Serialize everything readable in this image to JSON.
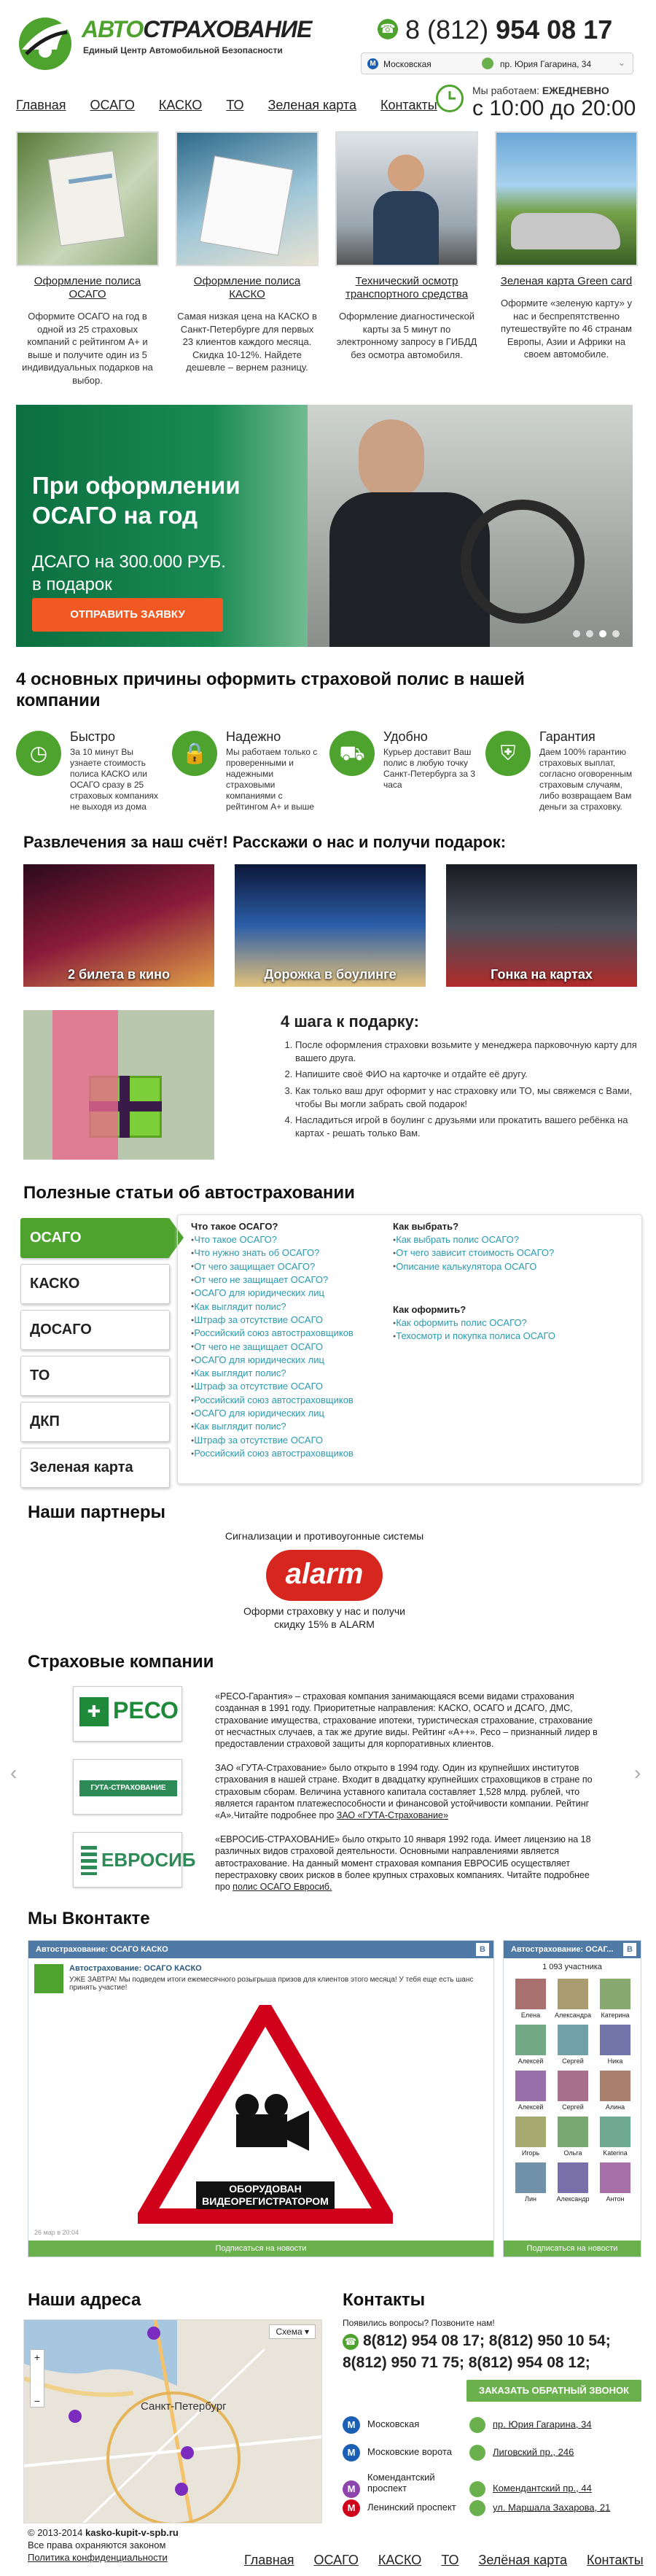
{
  "header": {
    "logo_title_a": "АВТО",
    "logo_title_b": "СТРАХОВАНИЕ",
    "logo_sub": "Единый Центр Автомобильной Безопасности",
    "phone_code": "8 (812)",
    "phone_num": "954 08 17",
    "addr_metro": "Московская",
    "addr_street": "пр. Юрия Гагарина, 34",
    "work_label": "Мы работаем:",
    "work_label_b": "ЕЖЕДНЕВНО",
    "work_hours": "с 10:00 до 20:00",
    "nav": [
      "Главная",
      "ОСАГО",
      "КАСКО",
      "ТО",
      "Зеленая карта",
      "Контакты"
    ]
  },
  "services": [
    {
      "title": "Оформление полиса ОСАГО",
      "desc": "Оформите ОСАГО на год в одной из 25 страховых компаний с рейтингом А+ и выше и получите один из 5 индивидуальных подарков на выбор."
    },
    {
      "title": "Оформление полиса КАСКО",
      "desc": "Самая низкая цена на КАСКО в Санкт-Петербурге для первых 23 клиентов каждого месяца. Скидка 10-12%. Найдете дешевле – вернем разницу."
    },
    {
      "title": "Технический осмотр транспортного средства",
      "desc": "Оформление диагностической карты за 5 минут по электронному запросу в ГИБДД без осмотра автомобиля."
    },
    {
      "title": "Зеленая карта Green card",
      "desc": "Оформите «зеленую карту» у нас и беспрепятственно путешествуйте по 46 странам Европы, Азии и Африки на своем автомобиле."
    }
  ],
  "banner": {
    "title1": "При оформлении",
    "title2": "ОСАГО на год",
    "sub1": "ДСАГО на 300.000 РУБ.",
    "sub2": "в подарок",
    "button": "ОТПРАВИТЬ ЗАЯВКУ"
  },
  "reasons": {
    "heading": "4 основных причины оформить страховой полис в нашей компании",
    "items": [
      {
        "title": "Быстро",
        "desc": "За 10 минут Вы узнаете стоимость полиса КАСКО или ОСАГО сразу в 25 страховых компаниях не выходя из дома"
      },
      {
        "title": "Надежно",
        "desc": "Мы работаем только с проверенными и надежными страховыми компаниями с рейтингом А+ и выше"
      },
      {
        "title": "Удобно",
        "desc": "Курьер доставит Ваш полис в любую точку Санкт-Петербурга за 3 часа"
      },
      {
        "title": "Гарантия",
        "desc": "Даем 100% гарантию страховых выплат, согласно оговоренным страховым случаям, либо возвращаем Вам деньги за страховку."
      }
    ]
  },
  "ent": {
    "heading": "Развлечения за наш счёт! Расскажи о нас и получи подарок:",
    "items": [
      "2 билета в кино",
      "Дорожка в боулинге",
      "Гонка на картах"
    ]
  },
  "steps": {
    "heading": "4 шага к подарку:",
    "items": [
      "После оформления страховки возьмите у менеджера парковочную карту для вашего друга.",
      "Напишите своё ФИО на карточке и отдайте её другу.",
      "Как только ваш друг оформит у нас страховку или ТО, мы свяжемся с Вами, чтобы Вы могли забрать свой подарок!",
      "Насладиться игрой в боулинг с друзьями или прокатить вашего ребёнка на картах - решать только Вам."
    ]
  },
  "articles": {
    "heading": "Полезные статьи об автостраховании",
    "tabs": [
      "ОСАГО",
      "КАСКО",
      "ДОСАГО",
      "ТО",
      "ДКП",
      "Зеленая карта"
    ],
    "col1_h": "Что такое ОСАГО?",
    "col1": [
      "Что такое ОСАГО?",
      "Что нужно знать об ОСАГО?",
      "От чего защищает ОСАГО?",
      "От чего не защищает ОСАГО?",
      "ОСАГО для юридических лиц",
      "Как выглядит полис?",
      "Штраф за отсутствие ОСАГО",
      "Российский союз автостраховщиков",
      "От чего не защищает ОСАГО",
      "ОСАГО для юридических лиц",
      "Как выглядит полис?",
      "Штраф за отсутствие ОСАГО",
      "Российский союз автостраховщиков",
      "ОСАГО для юридических лиц",
      "Как выглядит полис?",
      "Штраф за отсутствие ОСАГО",
      "Российский союз автостраховщиков"
    ],
    "col2_h": "Как выбрать?",
    "col2": [
      "Как выбрать полис ОСАГО?",
      "От чего зависит стоимость ОСАГО?",
      "Описание калькулятора ОСАГО"
    ],
    "col3_h": "Как оформить?",
    "col3": [
      "Как оформить полис ОСАГО?",
      "Техосмотр и покупка полиса ОСАГО"
    ]
  },
  "partners": {
    "heading": "Наши партнеры",
    "cat": "Сигнализации и противоугонные системы",
    "brand": "alarm",
    "note": "Оформи страховку у нас и получи скидку 15% в ALARM"
  },
  "insurers": {
    "heading": "Страховые компании",
    "items": [
      {
        "logo": "РЕСО",
        "text": "«РЕСО-Гарантия» – страховая компания занимающаяся всеми видами страхования созданная в 1991 году. Приоритетные направления: КАСКО, ОСАГО и ДСАГО, ДМС, страхование имущества, страхование ипотеки, туристическая страхование, страхование от несчастных случаев, а так же другие виды. Рейтинг «А++». Ресо – признанный лидер в предоставлении страховой защиты для корпоративных клиентов."
      },
      {
        "logo": "ГУТА-СТРАХОВАНИЕ",
        "text": "ЗАО «ГУТА-Страхование» было открыто в 1994 году. Один из крупнейших институтов страхования в нашей стране. Входит в двадцатку крупнейших страховщиков в стране по страховым сборам. Величина уставного капитала составляет 1,528 млрд. рублей, что является гарантом платежеспособности и финансовой устойчивости компании. Рейтинг «А».Читайте подробнее про",
        "link": "ЗАО «ГУТА-Страхование»"
      },
      {
        "logo": "ЕВРОСИБ",
        "text": "«ЕВРОСИБ-СТРАХОВАНИЕ» было открыто 10 января 1992 года. Имеет лицензию на 18 различных видов страховой деятельности. Основными направлениями является автострахование. На данный момент страховая компания ЕВРОСИБ осуществляет перестраховку своих рисков в более крупных страховых компаниях. Читайте подробнее про",
        "link": "полис ОСАГО Евросиб."
      }
    ]
  },
  "vk": {
    "heading": "Мы Вконтакте",
    "title1": "Автострахование: ОСАГО КАСКО",
    "title2": "Автострахование: ОСАГ...",
    "members": "1 093 участника",
    "post_title": "Автострахование: ОСАГО КАСКО",
    "post_text": "УЖЕ ЗАВТРА! Мы подведем итоги ежемесячного розыгрыша призов для клиентов этого месяца! У тебя еще есть шанс принять участие!",
    "sign1": "ОБОРУДОВАН",
    "sign2": "ВИДЕОРЕГИСТРАТОРОМ",
    "date": "26 мар в 20:04",
    "sub1": "Подписаться на новости",
    "sub2": "Подписаться на новости",
    "names": [
      "Елена",
      "Александра",
      "Катерина",
      "Алексей",
      "Сергей",
      "Ника",
      "Алексей",
      "Сергей",
      "Алина",
      "Игорь",
      "Ольга",
      "Katerina",
      "Лин",
      "Александр",
      "Антон"
    ]
  },
  "contacts": {
    "addr_heading": "Наши адреса",
    "heading": "Контакты",
    "question": "Появились вопросы? Позвоните нам!",
    "phones1": "8(812) 954 08 17; 8(812) 950 10 54;",
    "phones2": "8(812) 950 71 75; 8(812) 954 08 12;",
    "callback": "ЗАКАЗАТЬ ОБРАТНЫЙ ЗВОНОК",
    "list": [
      {
        "metro": "Московская",
        "addr": "пр. Юрия Гагарина, 34",
        "color": "#1a5fb4"
      },
      {
        "metro": "Московские ворота",
        "addr": "Лиговский пр., 246",
        "color": "#1a5fb4"
      },
      {
        "metro": "Комендантский проспект",
        "addr": "Комендантский пр., 44",
        "color": "#8e44ad"
      },
      {
        "metro": "Ленинский проспект",
        "addr": "ул. Маршала Захарова, 21",
        "color": "#d0021b"
      }
    ],
    "map_city": "Санкт-Петербург",
    "map_scheme": "Схема"
  },
  "footer": {
    "copy": "© 2013-2014",
    "site": "kasko-kupit-v-spb.ru",
    "rights": "Все права охраняются законом",
    "privacy": "Политика конфиденциальности",
    "nav": [
      "Главная",
      "ОСАГО",
      "КАСКО",
      "ТО",
      "Зелёная карта",
      "Контакты"
    ]
  }
}
